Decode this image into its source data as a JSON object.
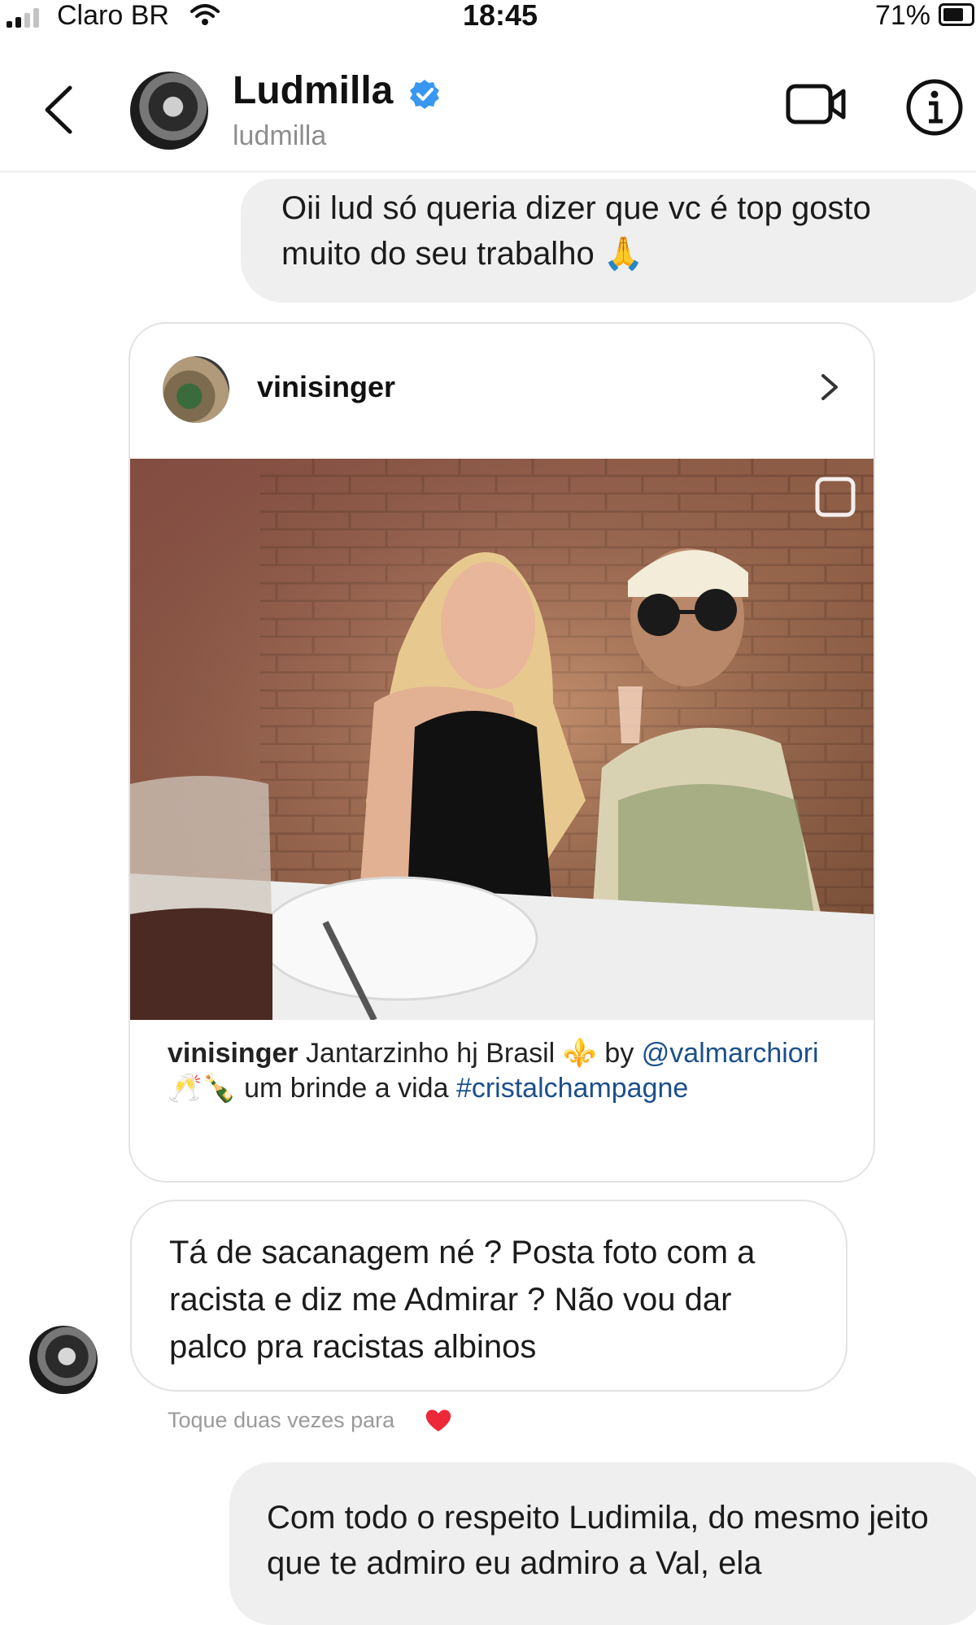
{
  "status_bar": {
    "carrier": "Claro BR",
    "time": "18:45",
    "battery": "71%",
    "battery_level": 0.71,
    "signal_bars": 2
  },
  "header": {
    "name": "Ludmilla",
    "username": "ludmilla",
    "verified": true,
    "icons": [
      "back-arrow-icon",
      "avatar",
      "verified-badge-icon",
      "video-call-icon",
      "info-icon"
    ]
  },
  "messages": {
    "sent_1": "Oii lud só queria dizer que vc é top gosto muito do seu trabalho 🙏",
    "shared_post": {
      "username": "vinisinger",
      "caption_user": "vinisinger",
      "caption_text": " Jantarzinho hj Brasil ⚜️ by ",
      "caption_mention": "@valmarchiori",
      "caption_text2": " 🥂🍾 um brinde a vida ",
      "caption_hashtag": "#cristalchampagne"
    },
    "received_1": "Tá de sacanagem né ? Posta foto com a racista e diz me Admirar ? Não vou dar palco pra racistas albinos",
    "like_hint": "Toque duas vezes para",
    "sent_2": "Com todo o respeito Ludimila, do mesmo jeito que te admiro eu admiro a Val, ela"
  },
  "colors": {
    "bubble_gray": "#efefef",
    "verified_blue": "#3897f0",
    "link_blue": "#1c4f8c",
    "heart_red": "#ed2939"
  }
}
